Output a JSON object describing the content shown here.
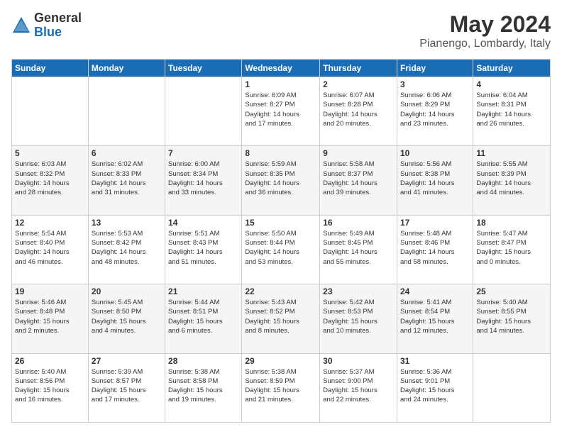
{
  "header": {
    "logo_line1": "General",
    "logo_line2": "Blue",
    "month": "May 2024",
    "location": "Pianengo, Lombardy, Italy"
  },
  "weekdays": [
    "Sunday",
    "Monday",
    "Tuesday",
    "Wednesday",
    "Thursday",
    "Friday",
    "Saturday"
  ],
  "weeks": [
    [
      {
        "day": "",
        "info": ""
      },
      {
        "day": "",
        "info": ""
      },
      {
        "day": "",
        "info": ""
      },
      {
        "day": "1",
        "info": "Sunrise: 6:09 AM\nSunset: 8:27 PM\nDaylight: 14 hours\nand 17 minutes."
      },
      {
        "day": "2",
        "info": "Sunrise: 6:07 AM\nSunset: 8:28 PM\nDaylight: 14 hours\nand 20 minutes."
      },
      {
        "day": "3",
        "info": "Sunrise: 6:06 AM\nSunset: 8:29 PM\nDaylight: 14 hours\nand 23 minutes."
      },
      {
        "day": "4",
        "info": "Sunrise: 6:04 AM\nSunset: 8:31 PM\nDaylight: 14 hours\nand 26 minutes."
      }
    ],
    [
      {
        "day": "5",
        "info": "Sunrise: 6:03 AM\nSunset: 8:32 PM\nDaylight: 14 hours\nand 28 minutes."
      },
      {
        "day": "6",
        "info": "Sunrise: 6:02 AM\nSunset: 8:33 PM\nDaylight: 14 hours\nand 31 minutes."
      },
      {
        "day": "7",
        "info": "Sunrise: 6:00 AM\nSunset: 8:34 PM\nDaylight: 14 hours\nand 33 minutes."
      },
      {
        "day": "8",
        "info": "Sunrise: 5:59 AM\nSunset: 8:35 PM\nDaylight: 14 hours\nand 36 minutes."
      },
      {
        "day": "9",
        "info": "Sunrise: 5:58 AM\nSunset: 8:37 PM\nDaylight: 14 hours\nand 39 minutes."
      },
      {
        "day": "10",
        "info": "Sunrise: 5:56 AM\nSunset: 8:38 PM\nDaylight: 14 hours\nand 41 minutes."
      },
      {
        "day": "11",
        "info": "Sunrise: 5:55 AM\nSunset: 8:39 PM\nDaylight: 14 hours\nand 44 minutes."
      }
    ],
    [
      {
        "day": "12",
        "info": "Sunrise: 5:54 AM\nSunset: 8:40 PM\nDaylight: 14 hours\nand 46 minutes."
      },
      {
        "day": "13",
        "info": "Sunrise: 5:53 AM\nSunset: 8:42 PM\nDaylight: 14 hours\nand 48 minutes."
      },
      {
        "day": "14",
        "info": "Sunrise: 5:51 AM\nSunset: 8:43 PM\nDaylight: 14 hours\nand 51 minutes."
      },
      {
        "day": "15",
        "info": "Sunrise: 5:50 AM\nSunset: 8:44 PM\nDaylight: 14 hours\nand 53 minutes."
      },
      {
        "day": "16",
        "info": "Sunrise: 5:49 AM\nSunset: 8:45 PM\nDaylight: 14 hours\nand 55 minutes."
      },
      {
        "day": "17",
        "info": "Sunrise: 5:48 AM\nSunset: 8:46 PM\nDaylight: 14 hours\nand 58 minutes."
      },
      {
        "day": "18",
        "info": "Sunrise: 5:47 AM\nSunset: 8:47 PM\nDaylight: 15 hours\nand 0 minutes."
      }
    ],
    [
      {
        "day": "19",
        "info": "Sunrise: 5:46 AM\nSunset: 8:48 PM\nDaylight: 15 hours\nand 2 minutes."
      },
      {
        "day": "20",
        "info": "Sunrise: 5:45 AM\nSunset: 8:50 PM\nDaylight: 15 hours\nand 4 minutes."
      },
      {
        "day": "21",
        "info": "Sunrise: 5:44 AM\nSunset: 8:51 PM\nDaylight: 15 hours\nand 6 minutes."
      },
      {
        "day": "22",
        "info": "Sunrise: 5:43 AM\nSunset: 8:52 PM\nDaylight: 15 hours\nand 8 minutes."
      },
      {
        "day": "23",
        "info": "Sunrise: 5:42 AM\nSunset: 8:53 PM\nDaylight: 15 hours\nand 10 minutes."
      },
      {
        "day": "24",
        "info": "Sunrise: 5:41 AM\nSunset: 8:54 PM\nDaylight: 15 hours\nand 12 minutes."
      },
      {
        "day": "25",
        "info": "Sunrise: 5:40 AM\nSunset: 8:55 PM\nDaylight: 15 hours\nand 14 minutes."
      }
    ],
    [
      {
        "day": "26",
        "info": "Sunrise: 5:40 AM\nSunset: 8:56 PM\nDaylight: 15 hours\nand 16 minutes."
      },
      {
        "day": "27",
        "info": "Sunrise: 5:39 AM\nSunset: 8:57 PM\nDaylight: 15 hours\nand 17 minutes."
      },
      {
        "day": "28",
        "info": "Sunrise: 5:38 AM\nSunset: 8:58 PM\nDaylight: 15 hours\nand 19 minutes."
      },
      {
        "day": "29",
        "info": "Sunrise: 5:38 AM\nSunset: 8:59 PM\nDaylight: 15 hours\nand 21 minutes."
      },
      {
        "day": "30",
        "info": "Sunrise: 5:37 AM\nSunset: 9:00 PM\nDaylight: 15 hours\nand 22 minutes."
      },
      {
        "day": "31",
        "info": "Sunrise: 5:36 AM\nSunset: 9:01 PM\nDaylight: 15 hours\nand 24 minutes."
      },
      {
        "day": "",
        "info": ""
      }
    ]
  ]
}
